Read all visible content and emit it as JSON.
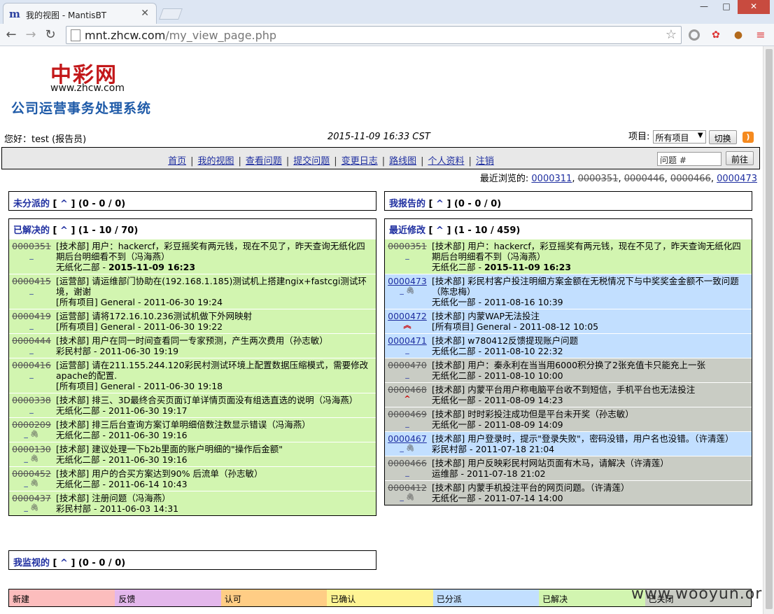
{
  "browser": {
    "tab_title": "我的视图 - MantisBT",
    "favicon": "m",
    "url_host": "mnt.zhcw.com",
    "url_path": "/my_view_page.php"
  },
  "logo": {
    "cn_title": "中彩网",
    "url": "www.zhcw.com",
    "system_name": "公司运营事务处理系统"
  },
  "header": {
    "greeting": "您好：test (报告员)",
    "datetime": "2015-11-09 16:33 CST",
    "project_label": "项目:",
    "project_value": "所有项目",
    "switch_label": "切换"
  },
  "menu": {
    "items": [
      "首页",
      "我的视图",
      "查看问题",
      "提交问题",
      "变更日志",
      "路线图",
      "个人资料",
      "注销"
    ],
    "issue_placeholder": "问题 #",
    "goto_label": "前往"
  },
  "recent": {
    "label": "最近浏览的:",
    "items": [
      {
        "id": "0000311",
        "struck": false
      },
      {
        "id": "0000351",
        "struck": true
      },
      {
        "id": "0000446",
        "struck": true
      },
      {
        "id": "0000466",
        "struck": true
      },
      {
        "id": "0000473",
        "struck": false
      }
    ]
  },
  "boxes": {
    "unassigned": {
      "title": "未分派的",
      "caret": "^",
      "range": "(0 - 0 / 0)"
    },
    "reported": {
      "title": "我报告的",
      "caret": "^",
      "range": "(0 - 0 / 0)"
    },
    "monitored": {
      "title": "我监视的",
      "caret": "^",
      "range": "(0 - 0 / 0)"
    },
    "resolved": {
      "title": "已解决的",
      "caret": "^",
      "range": "(1 - 10 / 70)",
      "rows": [
        {
          "id": "0000351",
          "struck": true,
          "clip": false,
          "pri": "",
          "color": "#d2f5b0",
          "summary": "[技术部] 用户：hackercf，彩豆摇奖有两元钱，现在不见了，昨天查询无纸化四期后台明细看不到（冯海燕）",
          "meta": "无纸化二部 - ",
          "date": "2015-11-09 16:23",
          "bold": true
        },
        {
          "id": "0000415",
          "struck": true,
          "clip": false,
          "pri": "",
          "color": "#d2f5b0",
          "summary": "[运营部] 请运维部门协助在(192.168.1.185)测试机上搭建ngix+fastcgi测试环境，谢谢",
          "meta": "[所有项目] General - ",
          "date": "2011-06-30 19:24",
          "bold": false
        },
        {
          "id": "0000419",
          "struck": true,
          "clip": false,
          "pri": "",
          "color": "#d2f5b0",
          "summary": "[运营部] 请将172.16.10.236测试机做下外网映射",
          "meta": "[所有项目] General - ",
          "date": "2011-06-30 19:22",
          "bold": false
        },
        {
          "id": "0000444",
          "struck": true,
          "clip": false,
          "pri": "",
          "color": "#d2f5b0",
          "summary": "[技术部] 用户在同一时间查看同一专家预测，产生两次费用（孙志敏）",
          "meta": "彩民村部 - ",
          "date": "2011-06-30 19:19",
          "bold": false
        },
        {
          "id": "0000416",
          "struck": true,
          "clip": false,
          "pri": "",
          "color": "#d2f5b0",
          "summary": "[运营部] 请在211.155.244.120彩民村测试环境上配置数据压缩模式，需要修改apache的配置.",
          "meta": "[所有项目] General - ",
          "date": "2011-06-30 19:18",
          "bold": false
        },
        {
          "id": "0000338",
          "struck": true,
          "clip": false,
          "pri": "",
          "color": "#d2f5b0",
          "summary": "[技术部] 排三、3D最终合买页面订单详情页面没有组选直选的说明（冯海燕）",
          "meta": "无纸化二部 - ",
          "date": "2011-06-30 19:17",
          "bold": false
        },
        {
          "id": "0000209",
          "struck": true,
          "clip": true,
          "pri": "",
          "color": "#d2f5b0",
          "summary": "[技术部] 排三后台查询方案订单明细倍数注数显示错误（冯海燕）",
          "meta": "无纸化二部 - ",
          "date": "2011-06-30 19:16",
          "bold": false
        },
        {
          "id": "0000130",
          "struck": true,
          "clip": true,
          "pri": "",
          "color": "#d2f5b0",
          "summary": "[技术部] 建议处理一下b2b里面的账户明细的\"操作后金额\"",
          "meta": "无纸化二部 - ",
          "date": "2011-06-30 19:16",
          "bold": false
        },
        {
          "id": "0000452",
          "struck": true,
          "clip": true,
          "pri": "",
          "color": "#d2f5b0",
          "summary": "[技术部] 用户的合买方案达到90% 后流单（孙志敏）",
          "meta": "无纸化二部 - ",
          "date": "2011-06-14 10:43",
          "bold": false
        },
        {
          "id": "0000437",
          "struck": true,
          "clip": true,
          "pri": "",
          "color": "#d2f5b0",
          "summary": "[技术部] 注册问题（冯海燕）",
          "meta": "彩民村部 - ",
          "date": "2011-06-03 14:31",
          "bold": false
        }
      ]
    },
    "recent_mod": {
      "title": "最近修改",
      "caret": "^",
      "range": "(1 - 10 / 459)",
      "rows": [
        {
          "id": "0000351",
          "struck": true,
          "clip": false,
          "pri": "",
          "color": "#d2f5b0",
          "summary": "[技术部] 用户：hackercf，彩豆摇奖有两元钱，现在不见了，昨天查询无纸化四期后台明细看不到（冯海燕）",
          "meta": "无纸化二部 - ",
          "date": "2015-11-09 16:23",
          "bold": true
        },
        {
          "id": "0000473",
          "struck": false,
          "clip": true,
          "pri": "",
          "color": "#c2dfff",
          "summary": "[技术部] 彩民村客户投注明细方案金额在无税情况下与中奖奖金金额不一致问题（陈忠梅）",
          "meta": "无纸化一部 - ",
          "date": "2011-08-16 10:39",
          "bold": false
        },
        {
          "id": "0000472",
          "struck": false,
          "clip": false,
          "pri": "high",
          "color": "#c2dfff",
          "summary": "[技术部] 内蒙WAP无法投注",
          "meta": "[所有项目] General - ",
          "date": "2011-08-12 10:05",
          "bold": false
        },
        {
          "id": "0000471",
          "struck": false,
          "clip": false,
          "pri": "",
          "color": "#c2dfff",
          "summary": "[技术部] w780412反馈提现账户问题",
          "meta": "无纸化二部 - ",
          "date": "2011-08-10 22:32",
          "bold": false
        },
        {
          "id": "0000470",
          "struck": true,
          "clip": false,
          "pri": "",
          "color": "#c9ccc4",
          "summary": "[技术部] 用户：秦永利在当当用6000积分换了2张充值卡只能充上一张",
          "meta": "无纸化二部 - ",
          "date": "2011-08-10 10:00",
          "bold": false
        },
        {
          "id": "0000468",
          "struck": true,
          "clip": false,
          "pri": "mid",
          "color": "#c9ccc4",
          "summary": "[技术部] 内蒙平台用户称电脑平台收不到短信，手机平台也无法投注",
          "meta": "无纸化一部 - ",
          "date": "2011-08-09 14:23",
          "bold": false
        },
        {
          "id": "0000469",
          "struck": true,
          "clip": false,
          "pri": "",
          "color": "#c9ccc4",
          "summary": "[技术部] 时时彩投注成功但是平台未开奖（孙志敏）",
          "meta": "无纸化一部 - ",
          "date": "2011-08-09 14:09",
          "bold": false
        },
        {
          "id": "0000467",
          "struck": false,
          "clip": true,
          "pri": "",
          "color": "#c2dfff",
          "summary": "[技术部] 用户登录时，提示\"登录失败\"，密码没错，用户名也没错。（许清莲）",
          "meta": "彩民村部 - ",
          "date": "2011-07-18 21:04",
          "bold": false
        },
        {
          "id": "0000466",
          "struck": true,
          "clip": false,
          "pri": "",
          "color": "#c9ccc4",
          "summary": "[技术部] 用户反映彩民村网站页面有木马，请解决（许清莲）",
          "meta": "运维部 - ",
          "date": "2011-07-18 21:02",
          "bold": false
        },
        {
          "id": "0000412",
          "struck": true,
          "clip": true,
          "pri": "",
          "color": "#c9ccc4",
          "summary": "[技术部] 内蒙手机投注平台的网页问题。（许清莲）",
          "meta": "无纸化一部 - ",
          "date": "2011-07-14 14:00",
          "bold": false
        }
      ]
    }
  },
  "legend": [
    {
      "label": "新建",
      "color": "#fcbdbd"
    },
    {
      "label": "反馈",
      "color": "#e3b7eb"
    },
    {
      "label": "认可",
      "color": "#ffcd85"
    },
    {
      "label": "已确认",
      "color": "#fff494"
    },
    {
      "label": "已分派",
      "color": "#c2dfff"
    },
    {
      "label": "已解决",
      "color": "#d2f5b0"
    },
    {
      "label": "已关闭",
      "color": "#c9ccc4"
    }
  ],
  "watermark": "www.wooyun.org"
}
